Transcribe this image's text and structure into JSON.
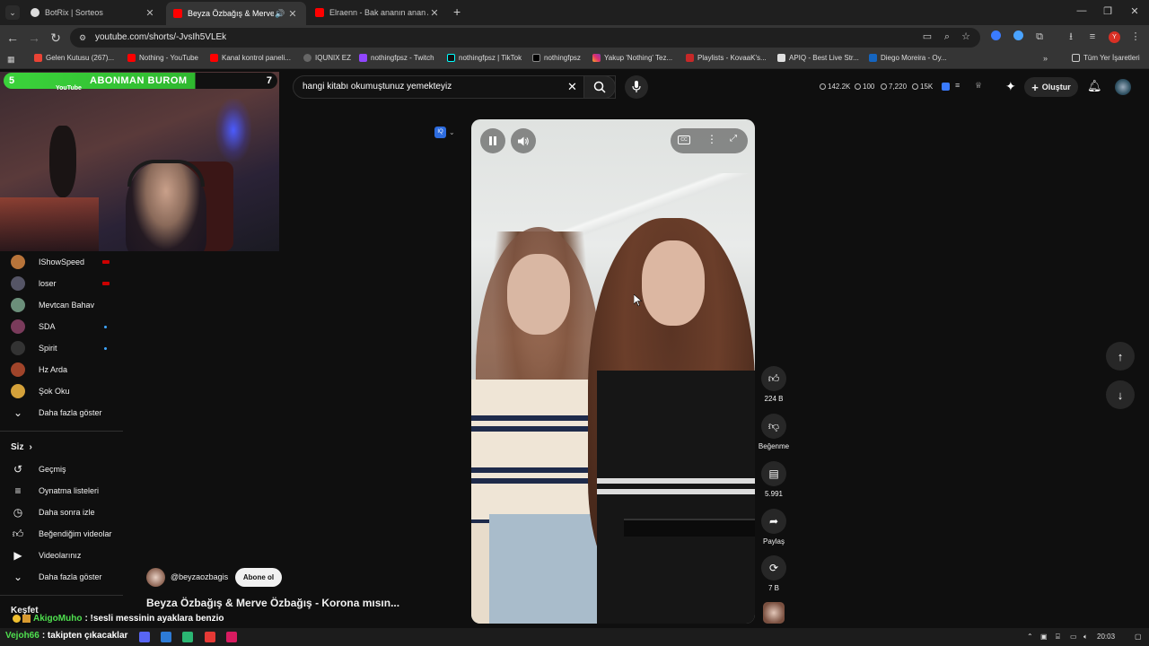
{
  "browser": {
    "tabs": [
      {
        "title": "BotRix | Sorteos",
        "active": false
      },
      {
        "title": "Beyza Özbağış & Merve Öz",
        "active": true
      },
      {
        "title": "Elraenn - Bak ananın anan ANA",
        "active": false
      }
    ],
    "url": "youtube.com/shorts/-JvsIh5VLEk",
    "bookmarks": [
      "Gelen Kutusu (267)...",
      "Nothing - YouTube",
      "Kanal kontrol paneli...",
      "IQUNIX EZ",
      "nothingfpsz - Twitch",
      "nothingfpsz | TikTok",
      "nothingfpsz",
      "Yakup 'Nothing' Tez...",
      "Playlists - KovaaK's...",
      "APIQ - Best Live Str...",
      "Diego Moreira - Oy..."
    ],
    "all_bookmarks": "Tüm Yer İşaretleri",
    "profile_initial": "Y"
  },
  "overlay": {
    "banner_left": "5",
    "banner_text": "ABONMAN BUROM",
    "banner_right": "7",
    "brand_text": "YouTube"
  },
  "youtube": {
    "search_value": "hangi kitabı okumuştunuz yemekteyiz",
    "stats": [
      "142.2K",
      "100",
      "7,220",
      "15K"
    ],
    "create_label": "Oluştur",
    "subscriptions": [
      {
        "name": "IShowSpeed",
        "badge": "live"
      },
      {
        "name": "loser",
        "badge": "live"
      },
      {
        "name": "Mevtcan Bahav",
        "badge": ""
      },
      {
        "name": "SDA",
        "badge": "new"
      },
      {
        "name": "Spirit",
        "badge": "new"
      },
      {
        "name": "Hz Arda",
        "badge": ""
      },
      {
        "name": "Şok Oku",
        "badge": ""
      }
    ],
    "show_more": "Daha fazla göster",
    "you_section": "Siz",
    "you_items": [
      {
        "label": "Geçmiş",
        "icon": "history-icon"
      },
      {
        "label": "Oynatma listeleri",
        "icon": "playlist-icon"
      },
      {
        "label": "Daha sonra izle",
        "icon": "clock-icon"
      },
      {
        "label": "Beğendiğim videolar",
        "icon": "thumb-up-icon"
      },
      {
        "label": "Videolarınız",
        "icon": "video-icon"
      }
    ],
    "show_more_2": "Daha fazla göster",
    "explore": "Keşfet",
    "channel_handle": "@beyzaozbagis",
    "subscribe_label": "Abone ol",
    "video_title": "Beyza Özbağış & Merve Özbağış - Korona mısın...",
    "likes": "224 B",
    "dislike_label": "Beğenme",
    "comments": "5.991",
    "share_label": "Paylaş",
    "remix_count": "7 B"
  },
  "chat": [
    {
      "user": "AkigoMuho",
      "message": ": !sesli messinin ayaklara benzio",
      "color": "#4fe04f"
    },
    {
      "user": "Vejoh66",
      "message": ": takipten çıkacaklar",
      "color": "#4fe04f"
    }
  ],
  "taskbar": {
    "time": "20:03"
  },
  "colors": {
    "accent": "#3ea6ff",
    "youtube_red": "#ff0000",
    "overlay_green": "#3bd33b"
  }
}
